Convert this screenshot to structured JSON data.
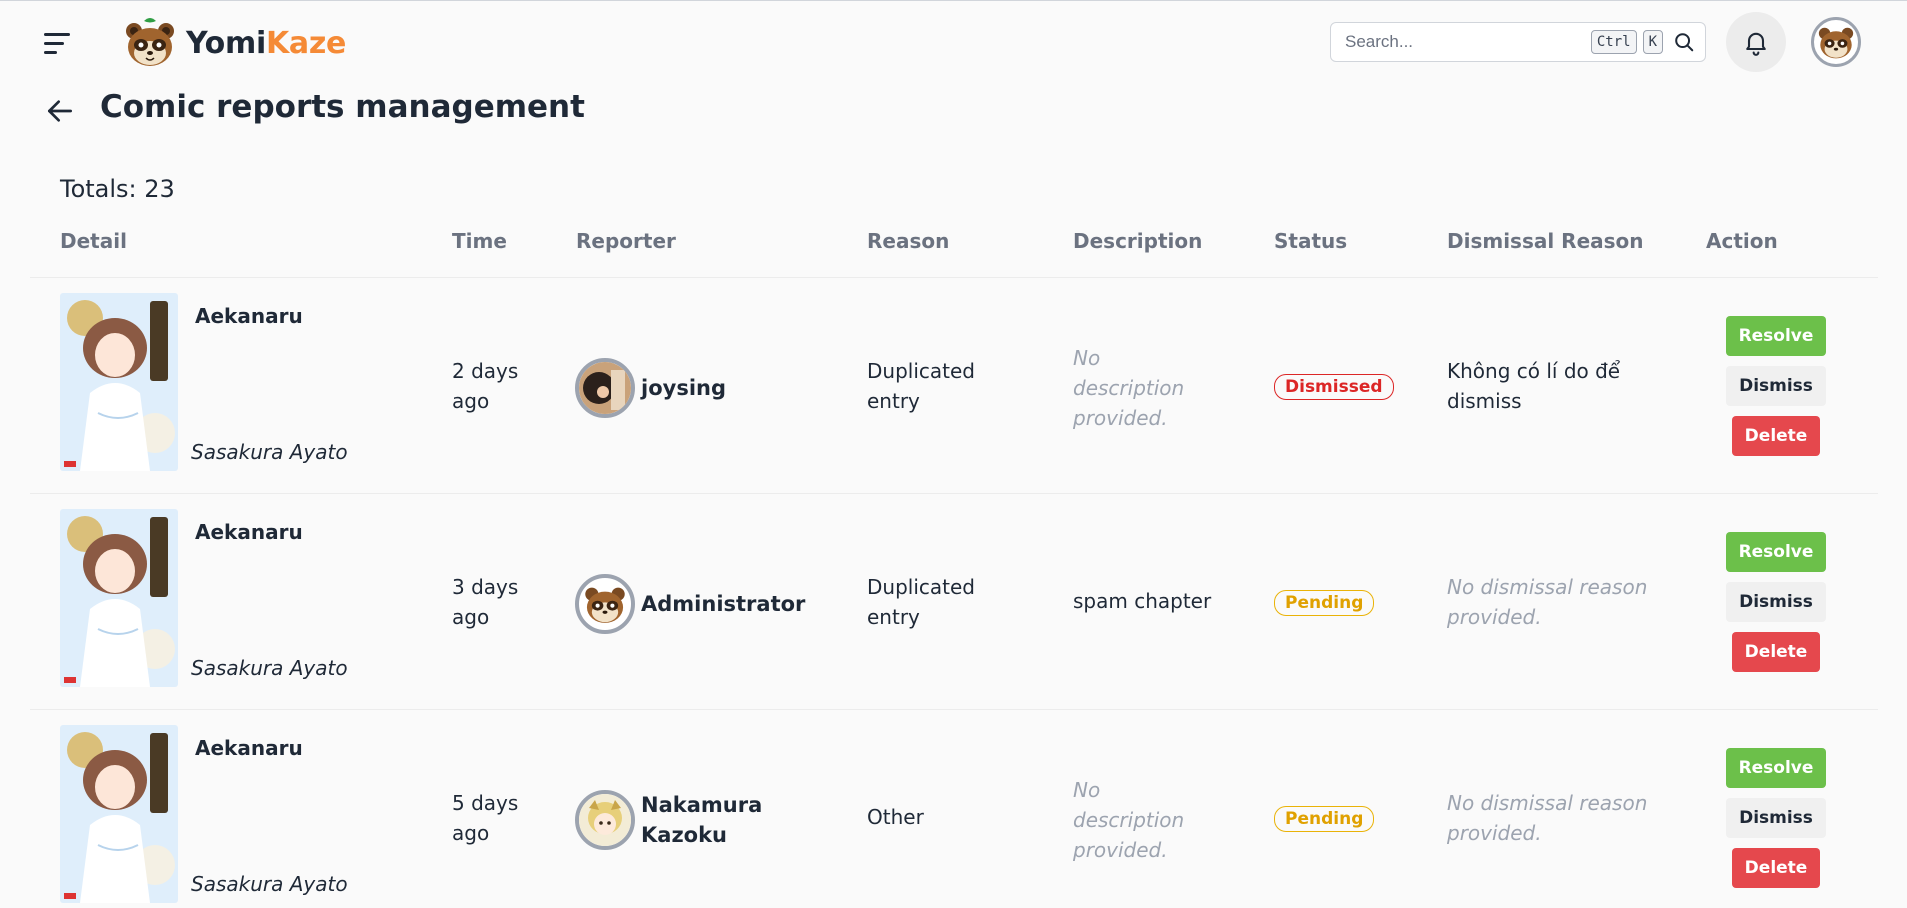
{
  "header": {
    "logo_part1": "Yomi",
    "logo_part2": "Kaze",
    "search_placeholder": "Search...",
    "kbd_ctrl": "Ctrl",
    "kbd_k": "K"
  },
  "page": {
    "title": "Comic reports management",
    "totals": "Totals: 23"
  },
  "table": {
    "columns": [
      "Detail",
      "Time",
      "Reporter",
      "Reason",
      "Description",
      "Status",
      "Dismissal Reason",
      "Action"
    ],
    "actions": {
      "resolve": "Resolve",
      "dismiss": "Dismiss",
      "delete": "Delete"
    },
    "rows": [
      {
        "comic_title": "Aekanaru",
        "comic_author": "Sasakura Ayato",
        "time": "2 days ago",
        "reporter": "joysing",
        "reason": "Duplicated entry",
        "description": "No description provided.",
        "status": "Dismissed",
        "dismissal_reason": "Không có lí do để dismiss"
      },
      {
        "comic_title": "Aekanaru",
        "comic_author": "Sasakura Ayato",
        "time": "3 days ago",
        "reporter": "Administrator",
        "reason": "Duplicated entry",
        "description": "spam chapter",
        "status": "Pending",
        "dismissal_reason": "No dismissal reason provided."
      },
      {
        "comic_title": "Aekanaru",
        "comic_author": "Sasakura Ayato",
        "time": "5 days ago",
        "reporter": "Nakamura Kazoku",
        "reason": "Other",
        "description": "No description provided.",
        "status": "Pending",
        "dismissal_reason": "No dismissal reason provided."
      }
    ]
  },
  "colors": {
    "brand_orange": "#f58a36",
    "resolve_green": "#6cc04a",
    "delete_red": "#e5484d",
    "dismissed_red": "#dc2626",
    "pending_yellow": "#eab308"
  }
}
